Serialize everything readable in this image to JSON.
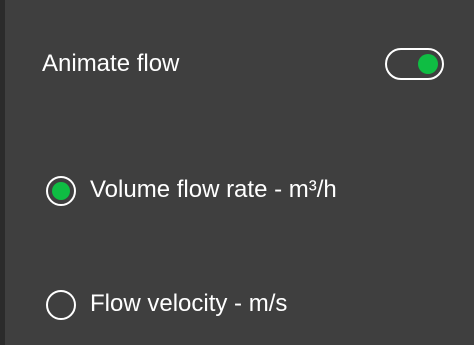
{
  "animate_flow": {
    "label": "Animate flow",
    "toggle_on": true
  },
  "units": {
    "options": [
      {
        "label": "Volume flow rate - m³/h",
        "selected": true
      },
      {
        "label": "Flow velocity - m/s",
        "selected": false
      }
    ]
  },
  "colors": {
    "background": "#3f3f3f",
    "edge": "#2b2b2b",
    "accent": "#0fbd43",
    "text": "#ffffff"
  }
}
